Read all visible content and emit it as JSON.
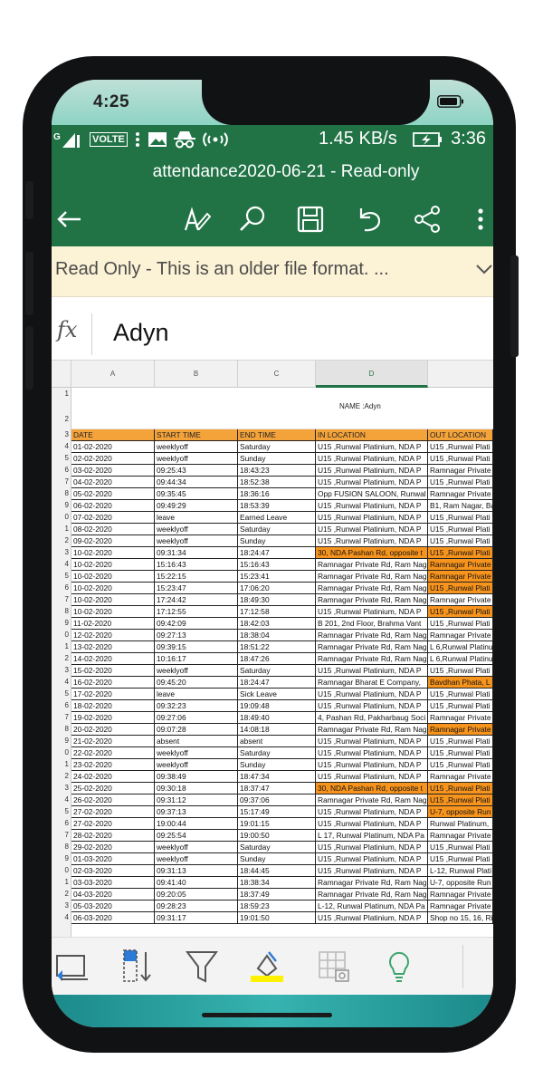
{
  "ios_status": {
    "time": "4:25"
  },
  "android_status": {
    "network": "VOLTE",
    "speed": "1.45 KB/s",
    "clock": "3:36"
  },
  "app": {
    "title": "attendance2020-06-21 - Read-only",
    "banner": "Read Only - This is an older file format. ...",
    "formula_value": "Adyn",
    "fx_label": "fx"
  },
  "columns": [
    "A",
    "B",
    "C",
    "D"
  ],
  "name_cell": "NAME :Adyn",
  "row_numbers": [
    "1",
    "2",
    "3",
    "4",
    "5",
    "6",
    "7",
    "8",
    "9",
    "0",
    "1",
    "2",
    "3",
    "4",
    "5",
    "6",
    "7",
    "8",
    "9",
    "0",
    "1",
    "2",
    "3",
    "4",
    "5",
    "6",
    "7",
    "8",
    "9",
    "0",
    "1",
    "2",
    "3",
    "4",
    "5",
    "6",
    "7",
    "8",
    "9",
    "0",
    "1",
    "2",
    "3",
    "4"
  ],
  "table": {
    "headers": [
      "DATE",
      "START TIME",
      "END TIME",
      "IN LOCATION",
      "OUT LOCATION"
    ],
    "rows": [
      {
        "c": [
          "01-02-2020",
          "weeklyoff",
          "Saturday",
          "U15 ,Runwal Platinium, NDA P",
          "U15 ,Runwal Plati"
        ],
        "hl": []
      },
      {
        "c": [
          "02-02-2020",
          "weeklyoff",
          "Sunday",
          "U15 ,Runwal Platinium, NDA P",
          "U15 ,Runwal Plati"
        ],
        "hl": []
      },
      {
        "c": [
          "03-02-2020",
          "09:25:43",
          "18:43:23",
          "U15 ,Runwal Platinium, NDA P",
          "Ramnagar Private"
        ],
        "hl": []
      },
      {
        "c": [
          "04-02-2020",
          "09:44:34",
          "18:52:38",
          "U15 ,Runwal Platinium, NDA P",
          "U15 ,Runwal Plati"
        ],
        "hl": []
      },
      {
        "c": [
          "05-02-2020",
          "09:35:45",
          "18:36:16",
          "Opp FUSION SALOON, Runwal",
          "Ramnagar Private"
        ],
        "hl": []
      },
      {
        "c": [
          "06-02-2020",
          "09:49:29",
          "18:53:39",
          "U15 ,Runwal Platinium, NDA P",
          "B1, Ram Nagar, Ba"
        ],
        "hl": []
      },
      {
        "c": [
          "07-02-2020",
          "leave",
          "Earned Leave",
          "U15 ,Runwal Platinium, NDA P",
          "U15 ,Runwal Plati"
        ],
        "hl": []
      },
      {
        "c": [
          "08-02-2020",
          "weeklyoff",
          "Saturday",
          "U15 ,Runwal Platinium, NDA P",
          "U15 ,Runwal Plati"
        ],
        "hl": []
      },
      {
        "c": [
          "09-02-2020",
          "weeklyoff",
          "Sunday",
          "U15 ,Runwal Platinium, NDA P",
          "U15 ,Runwal Plati"
        ],
        "hl": []
      },
      {
        "c": [
          "10-02-2020",
          "09:31:34",
          "18:24:47",
          "30, NDA Pashan Rd, opposite t",
          "U15 ,Runwal Plati"
        ],
        "hl": [
          3,
          4
        ]
      },
      {
        "c": [
          "10-02-2020",
          "15:16:43",
          "15:16:43",
          "Ramnagar Private Rd, Ram Nag",
          "Ramnagar Private"
        ],
        "hl": [
          4
        ]
      },
      {
        "c": [
          "10-02-2020",
          "15:22:15",
          "15:23:41",
          "Ramnagar Private Rd, Ram Nag",
          "Ramnagar Private"
        ],
        "hl": [
          4
        ]
      },
      {
        "c": [
          "10-02-2020",
          "15:23:47",
          "17:06:20",
          "Ramnagar Private Rd, Ram Nag",
          "U15 ,Runwal Plati"
        ],
        "hl": [
          4
        ]
      },
      {
        "c": [
          "10-02-2020",
          "17:24:42",
          "18:49:30",
          "Ramnagar Private Rd, Ram Nag",
          "Ramnagar Private"
        ],
        "hl": []
      },
      {
        "c": [
          "10-02-2020",
          "17:12:55",
          "17:12:58",
          "U15 ,Runwal Platinium, NDA P",
          "U15 ,Runwal Plati"
        ],
        "hl": [
          4
        ]
      },
      {
        "c": [
          "11-02-2020",
          "09:42:09",
          "18:42:03",
          "B 201, 2nd Floor, Brahma Vant",
          "U15 ,Runwal Plati"
        ],
        "hl": []
      },
      {
        "c": [
          "12-02-2020",
          "09:27:13",
          "18:38:04",
          "Ramnagar Private Rd, Ram Nag",
          "Ramnagar Private"
        ],
        "hl": []
      },
      {
        "c": [
          "13-02-2020",
          "09:39:15",
          "18:51:22",
          "Ramnagar Private Rd, Ram Nag",
          "L 6,Runwal Platinu"
        ],
        "hl": []
      },
      {
        "c": [
          "14-02-2020",
          "10:16:17",
          "18:47:26",
          "Ramnagar Private Rd, Ram Nag",
          "L 6,Runwal Platinu"
        ],
        "hl": []
      },
      {
        "c": [
          "15-02-2020",
          "weeklyoff",
          "Saturday",
          "U15 ,Runwal Platinium, NDA P",
          "U15 ,Runwal Plati"
        ],
        "hl": []
      },
      {
        "c": [
          "16-02-2020",
          "09:45:20",
          "18:24:47",
          "Ramnagar Bharat E Company,",
          "Bavdhan Phata, L"
        ],
        "hl": [
          4
        ]
      },
      {
        "c": [
          "17-02-2020",
          "leave",
          "Sick Leave",
          "U15 ,Runwal Platinium, NDA P",
          "U15 ,Runwal Plati"
        ],
        "hl": []
      },
      {
        "c": [
          "18-02-2020",
          "09:32:23",
          "19:09:48",
          "U15 ,Runwal Platinium, NDA P",
          "U15 ,Runwal Plati"
        ],
        "hl": []
      },
      {
        "c": [
          "19-02-2020",
          "09:27:06",
          "18:49:40",
          "4, Pashan Rd, Pakharbaug Soci",
          "Ramnagar Private"
        ],
        "hl": []
      },
      {
        "c": [
          "20-02-2020",
          "09:07:28",
          "14:08:18",
          "Ramnagar Private Rd, Ram Nag",
          "Ramnagar Private"
        ],
        "hl": [
          4
        ]
      },
      {
        "c": [
          "21-02-2020",
          "absent",
          "absent",
          "U15 ,Runwal Platinium, NDA P",
          "U15 ,Runwal Plati"
        ],
        "hl": []
      },
      {
        "c": [
          "22-02-2020",
          "weeklyoff",
          "Saturday",
          "U15 ,Runwal Platinium, NDA P",
          "U15 ,Runwal Plati"
        ],
        "hl": []
      },
      {
        "c": [
          "23-02-2020",
          "weeklyoff",
          "Sunday",
          "U15 ,Runwal Platinium, NDA P",
          "U15 ,Runwal Plati"
        ],
        "hl": []
      },
      {
        "c": [
          "24-02-2020",
          "09:38:49",
          "18:47:34",
          "U15 ,Runwal Platinium, NDA P",
          "Ramnagar Private"
        ],
        "hl": []
      },
      {
        "c": [
          "25-02-2020",
          "09:30:18",
          "18:37:47",
          "30, NDA Pashan Rd, opposite t",
          "U15 ,Runwal Plati"
        ],
        "hl": [
          3,
          4
        ]
      },
      {
        "c": [
          "26-02-2020",
          "09:31:12",
          "09:37:06",
          "Ramnagar Private Rd, Ram Nag",
          "U15 ,Runwal Plati"
        ],
        "hl": [
          4
        ]
      },
      {
        "c": [
          "27-02-2020",
          "09:37:13",
          "15:17:49",
          "U15 ,Runwal Platinium, NDA P",
          "U-7, opposite Run"
        ],
        "hl": [
          4
        ]
      },
      {
        "c": [
          "27-02-2020",
          "19:00:44",
          "19:01:15",
          "U15 ,Runwal Platinium, NDA P",
          "Runwal Platinum,"
        ],
        "hl": []
      },
      {
        "c": [
          "28-02-2020",
          "09:25:54",
          "19:00:50",
          "L 17, Runwal Platinum, NDA Pa",
          "Ramnagar Private"
        ],
        "hl": []
      },
      {
        "c": [
          "29-02-2020",
          "weeklyoff",
          "Saturday",
          "U15 ,Runwal Platinium, NDA P",
          "U15 ,Runwal Plati"
        ],
        "hl": []
      },
      {
        "c": [
          "01-03-2020",
          "weeklyoff",
          "Sunday",
          "U15 ,Runwal Platinium, NDA P",
          "U15 ,Runwal Plati"
        ],
        "hl": []
      },
      {
        "c": [
          "02-03-2020",
          "09:31:13",
          "18:44:45",
          "U15 ,Runwal Platinium, NDA P",
          "L-12, Runwal Plati"
        ],
        "hl": []
      },
      {
        "c": [
          "03-03-2020",
          "09:41:40",
          "18:38:34",
          "Ramnagar Private Rd, Ram Nag",
          "U-7, opposite Run"
        ],
        "hl": []
      },
      {
        "c": [
          "04-03-2020",
          "09:20:05",
          "18:37:49",
          "Ramnagar Private Rd, Ram Nag",
          "Ramnagar Private"
        ],
        "hl": []
      },
      {
        "c": [
          "05-03-2020",
          "09:28:23",
          "18:59:23",
          "L-12, Runwal Platinum, NDA Pa",
          "Ramnagar Private"
        ],
        "hl": []
      },
      {
        "c": [
          "06-03-2020",
          "09:31:17",
          "19:01:50",
          "U15 ,Runwal Platinium, NDA P",
          "Shop no 15, 16, Ri"
        ],
        "hl": []
      }
    ]
  },
  "colors": {
    "excel_green": "#217346",
    "header_orange": "#f4a23a",
    "highlight_orange": "#f7941d",
    "banner_yellow": "#fcf2d5"
  },
  "icons": {
    "toolbar": [
      "back-arrow-icon",
      "draw-pen-icon",
      "search-icon",
      "save-icon",
      "undo-icon",
      "share-icon",
      "more-vert-icon"
    ],
    "bottom": [
      "freeze-panes-icon",
      "sort-icon",
      "filter-icon",
      "fill-color-icon",
      "insert-picture-table-icon",
      "lightbulb-icon"
    ]
  }
}
